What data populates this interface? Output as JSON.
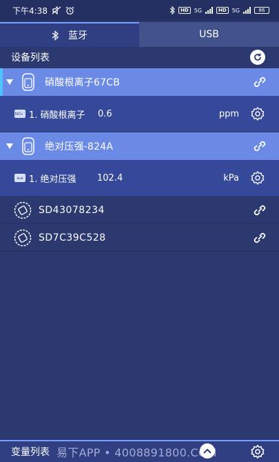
{
  "status_bar": {
    "time": "下午4:38",
    "hd1": "HD",
    "net1": "5G",
    "hd2": "HD",
    "net2": "5G",
    "battery": "86"
  },
  "tabs": [
    {
      "label": "蓝牙",
      "icon": "bluetooth-icon",
      "selected": true
    },
    {
      "label": "USB",
      "selected": false
    }
  ],
  "device_list": {
    "title": "设备列表"
  },
  "devices": [
    {
      "name": "硝酸根离子67CB",
      "sensor": {
        "label": "1. 硝酸根离子",
        "badge": "NO₃⁻",
        "value": "0.6",
        "unit": "ppm"
      }
    },
    {
      "name": "绝对压强-824A",
      "sensor": {
        "label": "1. 绝对压强",
        "badge": "≡≡",
        "value": "102.4",
        "unit": "kPa"
      }
    },
    {
      "name": "SD43078234"
    },
    {
      "name": "SD7C39C528"
    }
  ],
  "bottom": {
    "title": "变量列表",
    "watermark": "易下APP • 4008891800.COM"
  },
  "colors": {
    "background": "#2b3970",
    "device_row": "#6a8ae6",
    "sensor_row": "#35489a",
    "accent": "#7aa0ff"
  }
}
